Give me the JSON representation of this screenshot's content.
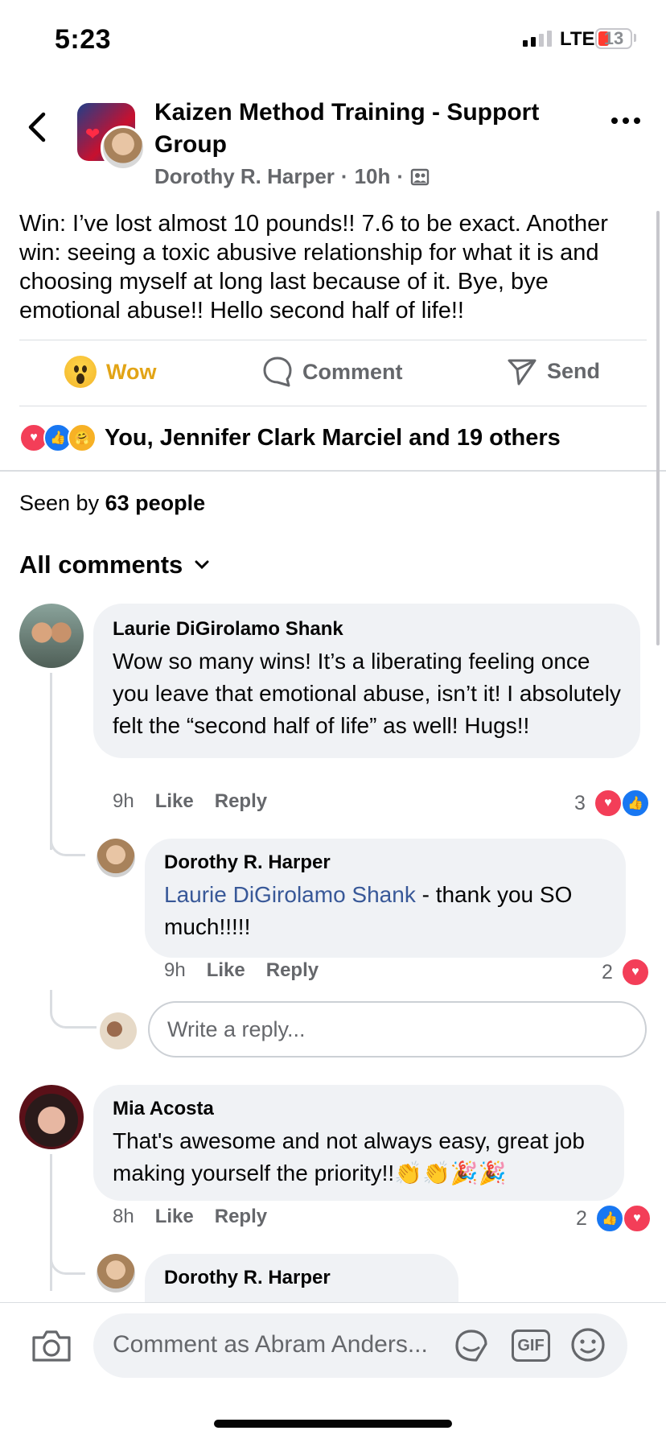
{
  "status": {
    "time": "5:23",
    "network": "LTE",
    "battery": "13"
  },
  "header": {
    "group_title": "Kaizen Method Training - Support Group",
    "author": "Dorothy R. Harper",
    "age": "10h",
    "sep": "·"
  },
  "post": {
    "text": "Win: I’ve lost almost 10 pounds!! 7.6 to be exact. Another win: seeing a toxic abusive relationship for what it is and choosing myself at long last because of it. Bye, bye emotional abuse!! Hello second half of life!!"
  },
  "actions": {
    "reaction": "Wow",
    "comment": "Comment",
    "send": "Send"
  },
  "reactions_summary": "You, Jennifer Clark Marciel and 19 others",
  "seen": {
    "prefix": "Seen by",
    "count": "63 people"
  },
  "comments_filter": "All comments",
  "comments": [
    {
      "name": "Laurie DiGirolamo Shank",
      "text": "Wow so many wins! It’s a liberating feeling once you leave that emotional abuse, isn’t it! I absolutely felt the “second half of life” as well! Hugs!!",
      "time": "9h",
      "like": "Like",
      "reply": "Reply",
      "count": "3"
    },
    {
      "name": "Dorothy R. Harper",
      "mention": "Laurie DiGirolamo Shank",
      "text": " - thank you SO much!!!!!",
      "time": "9h",
      "like": "Like",
      "reply": "Reply",
      "count": "2"
    },
    {
      "name": "Mia Acosta",
      "text": "That's awesome and not always easy, great job making yourself the priority!!👏👏🎉🎉",
      "time": "8h",
      "like": "Like",
      "reply": "Reply",
      "count": "2"
    },
    {
      "name": "Dorothy R. Harper"
    }
  ],
  "reply_placeholder": "Write a reply...",
  "composer_placeholder": "Comment as Abram Anders...",
  "gif_label": "GIF"
}
